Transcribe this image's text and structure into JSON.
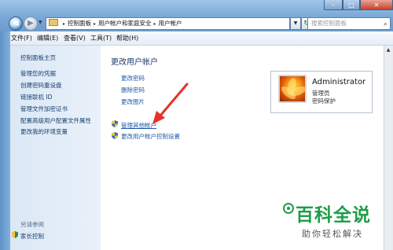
{
  "window": {
    "breadcrumb": [
      "控制面板",
      "用户帐户和家庭安全",
      "用户帐户"
    ],
    "search_placeholder": "搜索控制面板"
  },
  "menu": [
    "文件(F)",
    "编辑(E)",
    "查看(V)",
    "工具(T)",
    "帮助(H)"
  ],
  "sidebar": {
    "home": "控制面板主页",
    "links": [
      "管理您的凭据",
      "创建密码重设盘",
      "链接联机 ID",
      "管理文件加密证书",
      "配置高级用户配置文件属性",
      "更改我的环境变量"
    ],
    "see_also": "另请参阅",
    "parental_controls": "家长控制"
  },
  "main": {
    "title": "更改用户帐户",
    "tasks": [
      "更改密码",
      "删除密码",
      "更改图片"
    ],
    "manage_other": "管理其他帐户",
    "uac": "更改用户帐户控制设置"
  },
  "account": {
    "name": "Administrator",
    "role": "管理员",
    "protection": "密码保护"
  },
  "watermark": {
    "title": "百科全说",
    "subtitle": "助你轻松解决"
  },
  "colors": {
    "link": "#1c5aa8",
    "arrow": "#e8302a",
    "watermark": "#1f9d4a"
  }
}
